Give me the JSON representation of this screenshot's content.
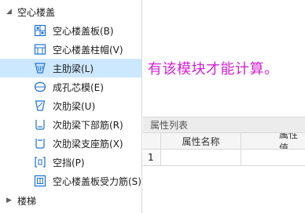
{
  "tree": {
    "group_floor": {
      "label": "空心楼盖",
      "expanded": true
    },
    "items": [
      {
        "label": "空心楼盖板(B)",
        "icon": "hollow-slab-icon"
      },
      {
        "label": "空心楼盖柱帽(V)",
        "icon": "column-cap-icon"
      },
      {
        "label": "主肋梁(L)",
        "icon": "main-rib-beam-icon",
        "selected": true
      },
      {
        "label": "成孔芯模(E)",
        "icon": "core-mold-icon"
      },
      {
        "label": "次肋梁(U)",
        "icon": "secondary-rib-beam-icon"
      },
      {
        "label": "次肋梁下部筋(R)",
        "icon": "bottom-rebar-icon"
      },
      {
        "label": "次肋梁支座筋(X)",
        "icon": "support-rebar-icon"
      },
      {
        "label": "空挡(P)",
        "icon": "gap-icon"
      },
      {
        "label": "空心楼盖板受力筋(S)",
        "icon": "stress-rebar-icon"
      }
    ],
    "group_stairs": {
      "label": "楼梯",
      "expanded": false
    }
  },
  "hint_text": "有该模块才能计算。",
  "properties": {
    "title": "属性列表",
    "columns": [
      "属性名称",
      "属性值"
    ],
    "rows": [
      {
        "index": "1",
        "name": "",
        "value": ""
      }
    ]
  },
  "colors": {
    "selected_bg": "#cce8ff",
    "hint": "#d321d3",
    "icon_blue": "#1f6fd1"
  }
}
